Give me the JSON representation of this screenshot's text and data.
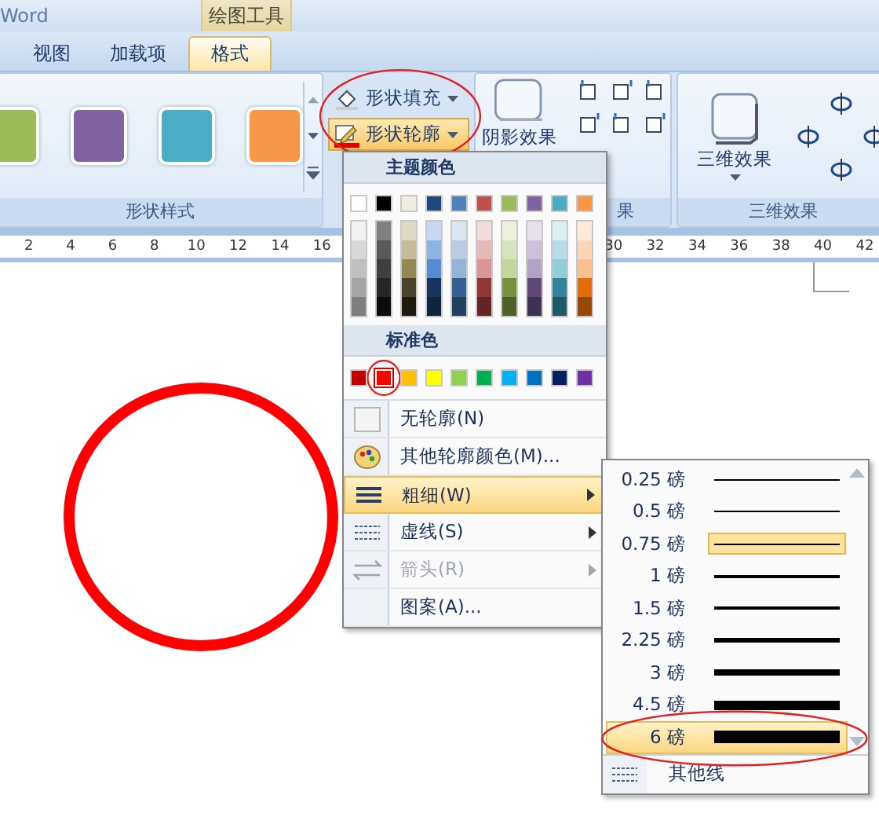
{
  "window": {
    "title": "Word",
    "context_tab": "绘图工具"
  },
  "tabs": [
    {
      "label": "视图",
      "selected": false
    },
    {
      "label": "加载项",
      "selected": false
    },
    {
      "label": "格式",
      "selected": true
    }
  ],
  "ribbon": {
    "style_group": {
      "label": "形状样式",
      "swatches": [
        {
          "color": "#9bbb59"
        },
        {
          "color": "#8064a2"
        },
        {
          "color": "#4bacc6"
        },
        {
          "color": "#f79646"
        }
      ]
    },
    "fill_button": {
      "label": "形状填充",
      "active": false
    },
    "outline_button": {
      "label": "形状轮廓",
      "active": true,
      "circled": true
    },
    "shadow_group": {
      "button": "阴影效果",
      "label": "果"
    },
    "three_d_group": {
      "button": "三维效果",
      "label": "三维效果"
    }
  },
  "ruler": {
    "left_ticks": [
      "2",
      "4",
      "6",
      "8",
      "10",
      "12",
      "14",
      "16"
    ],
    "right_ticks": [
      "30",
      "32",
      "34",
      "36",
      "38",
      "40",
      "42"
    ]
  },
  "document": {
    "shape": {
      "kind": "circle",
      "color": "#ff0000"
    }
  },
  "outline_menu": {
    "theme_heading": "主题颜色",
    "theme_colors": [
      {
        "color": "#ffffff",
        "shades": [
          {
            "color": "#f2f2f2"
          },
          {
            "color": "#d8d8d8"
          },
          {
            "color": "#bfbfbf"
          },
          {
            "color": "#a5a5a5"
          },
          {
            "color": "#7f7f7f"
          }
        ]
      },
      {
        "color": "#000000",
        "shades": [
          {
            "color": "#7f7f7f"
          },
          {
            "color": "#595959"
          },
          {
            "color": "#3f3f3f"
          },
          {
            "color": "#262626"
          },
          {
            "color": "#0c0c0c"
          }
        ]
      },
      {
        "color": "#eeece1",
        "shades": [
          {
            "color": "#ddd9c3"
          },
          {
            "color": "#c4bd97"
          },
          {
            "color": "#938953"
          },
          {
            "color": "#494429"
          },
          {
            "color": "#1d1b10"
          }
        ]
      },
      {
        "color": "#1f497d",
        "shades": [
          {
            "color": "#c6d9f0"
          },
          {
            "color": "#8db3e2"
          },
          {
            "color": "#548dd4"
          },
          {
            "color": "#17365d"
          },
          {
            "color": "#0f243e"
          }
        ]
      },
      {
        "color": "#4f81bd",
        "shades": [
          {
            "color": "#dbe5f1"
          },
          {
            "color": "#b8cce4"
          },
          {
            "color": "#95b3d7"
          },
          {
            "color": "#366092"
          },
          {
            "color": "#244061"
          }
        ]
      },
      {
        "color": "#c0504d",
        "shades": [
          {
            "color": "#f2dcdb"
          },
          {
            "color": "#e5b9b7"
          },
          {
            "color": "#d99694"
          },
          {
            "color": "#953734"
          },
          {
            "color": "#632423"
          }
        ]
      },
      {
        "color": "#9bbb59",
        "shades": [
          {
            "color": "#ebf1dd"
          },
          {
            "color": "#d7e3bc"
          },
          {
            "color": "#c3d69b"
          },
          {
            "color": "#76923c"
          },
          {
            "color": "#4f6128"
          }
        ]
      },
      {
        "color": "#8064a2",
        "shades": [
          {
            "color": "#e5e0ec"
          },
          {
            "color": "#ccc1d9"
          },
          {
            "color": "#b2a2c7"
          },
          {
            "color": "#5f497a"
          },
          {
            "color": "#3f3151"
          }
        ]
      },
      {
        "color": "#4bacc6",
        "shades": [
          {
            "color": "#dbeef3"
          },
          {
            "color": "#b7dde8"
          },
          {
            "color": "#92cddc"
          },
          {
            "color": "#31859b"
          },
          {
            "color": "#205867"
          }
        ]
      },
      {
        "color": "#f79646",
        "shades": [
          {
            "color": "#fdeada"
          },
          {
            "color": "#fbd5b5"
          },
          {
            "color": "#fac08f"
          },
          {
            "color": "#e36c09"
          },
          {
            "color": "#974806"
          }
        ]
      }
    ],
    "standard_heading": "标准色",
    "standard_colors": [
      {
        "color": "#c00000",
        "selected": false,
        "circled": false
      },
      {
        "color": "#ff0000",
        "selected": true,
        "circled": true
      },
      {
        "color": "#ffc000",
        "selected": false,
        "circled": false
      },
      {
        "color": "#ffff00",
        "selected": false,
        "circled": false
      },
      {
        "color": "#92d050",
        "selected": false,
        "circled": false
      },
      {
        "color": "#00b050",
        "selected": false,
        "circled": false
      },
      {
        "color": "#00b0f0",
        "selected": false,
        "circled": false
      },
      {
        "color": "#0070c0",
        "selected": false,
        "circled": false
      },
      {
        "color": "#002060",
        "selected": false,
        "circled": false
      },
      {
        "color": "#7030a0",
        "selected": false,
        "circled": false
      }
    ],
    "items": [
      {
        "label": "无轮廓(N)",
        "kind": "plain",
        "highlighted": false,
        "disabled": false
      },
      {
        "label": "其他轮廓颜色(M)...",
        "kind": "plain",
        "highlighted": false,
        "disabled": false
      },
      {
        "label": "粗细(W)",
        "kind": "submenu",
        "highlighted": true,
        "disabled": false
      },
      {
        "label": "虚线(S)",
        "kind": "submenu",
        "highlighted": false,
        "disabled": false
      },
      {
        "label": "箭头(R)",
        "kind": "submenu",
        "highlighted": false,
        "disabled": true
      },
      {
        "label": "图案(A)...",
        "kind": "plain",
        "highlighted": false,
        "disabled": false
      }
    ]
  },
  "weight_menu": {
    "items": [
      {
        "label": "0.25 磅",
        "selected": false,
        "highlighted": false,
        "circled": false
      },
      {
        "label": "0.5 磅",
        "selected": false,
        "highlighted": false,
        "circled": false
      },
      {
        "label": "0.75 磅",
        "selected": true,
        "highlighted": false,
        "circled": false
      },
      {
        "label": "1 磅",
        "selected": false,
        "highlighted": false,
        "circled": false
      },
      {
        "label": "1.5 磅",
        "selected": false,
        "highlighted": false,
        "circled": false
      },
      {
        "label": "2.25 磅",
        "selected": false,
        "highlighted": false,
        "circled": false
      },
      {
        "label": "3 磅",
        "selected": false,
        "highlighted": false,
        "circled": false
      },
      {
        "label": "4.5 磅",
        "selected": false,
        "highlighted": false,
        "circled": false
      },
      {
        "label": "6 磅",
        "selected": false,
        "highlighted": true,
        "circled": true
      }
    ],
    "footer": "其他线"
  }
}
